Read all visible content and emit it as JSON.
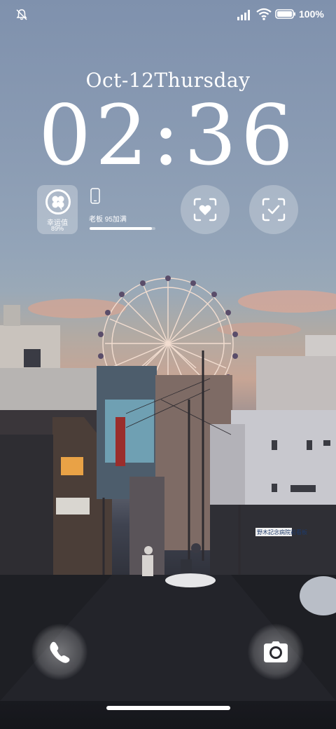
{
  "status_bar": {
    "battery_percent": "100%",
    "icons": [
      "silent-bell-icon",
      "signal-icon",
      "wifi-icon",
      "battery-icon"
    ]
  },
  "lock_screen": {
    "date": "Oct-12Thursday",
    "time": "02:36"
  },
  "widgets": {
    "luck": {
      "label": "幸运值",
      "value": "89%"
    },
    "device": {
      "label": "老板 95加满",
      "progress": 0.95
    },
    "face_button_icon": "face-heart-icon",
    "check_button_icon": "scan-check-icon"
  },
  "shortcuts": {
    "left_icon": "phone-icon",
    "right_icon": "camera-icon"
  },
  "wallpaper": {
    "signs": [
      "野木記念病院前看板"
    ]
  }
}
